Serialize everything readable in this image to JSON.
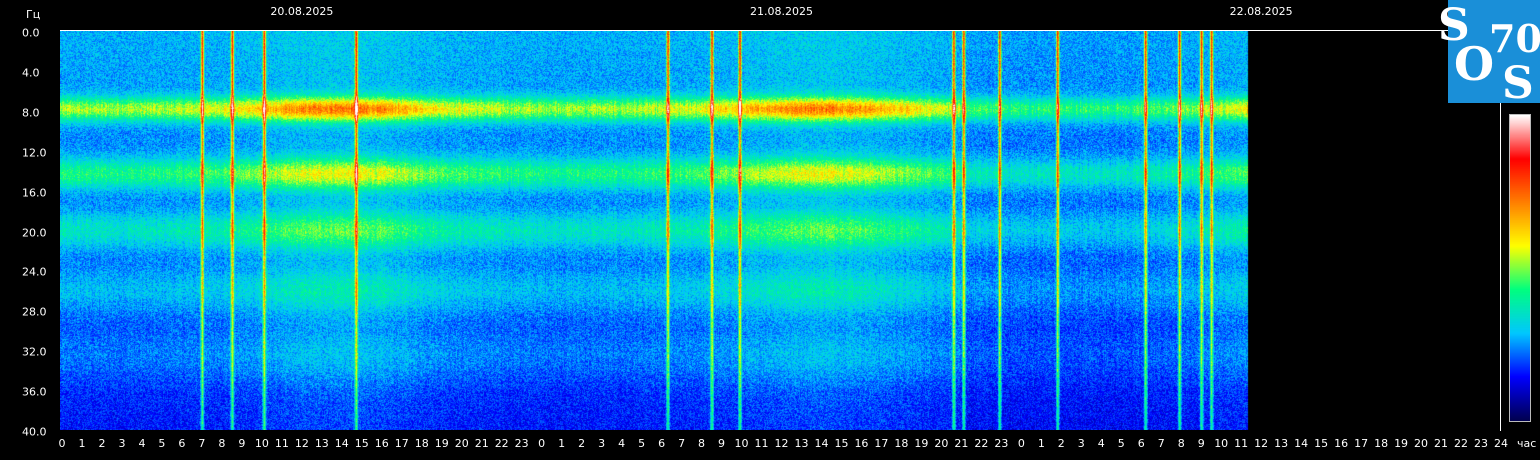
{
  "chart_data": {
    "type": "heatmap",
    "ylabel": "Гц",
    "xlabel": "час",
    "ylim": [
      0,
      40
    ],
    "y_ticks": [
      "0.0",
      "4.0",
      "8.0",
      "12.0",
      "16.0",
      "20.0",
      "24.0",
      "28.0",
      "32.0",
      "36.0",
      "40.0"
    ],
    "x_ticks": [
      "0",
      "1",
      "2",
      "3",
      "4",
      "5",
      "6",
      "7",
      "8",
      "9",
      "10",
      "11",
      "12",
      "13",
      "14",
      "15",
      "16",
      "17",
      "18",
      "19",
      "20",
      "21",
      "22",
      "23",
      "0",
      "1",
      "2",
      "3",
      "4",
      "5",
      "6",
      "7",
      "8",
      "9",
      "10",
      "11",
      "12",
      "13",
      "14",
      "15",
      "16",
      "17",
      "18",
      "19",
      "20",
      "21",
      "22",
      "23",
      "0",
      "1",
      "2",
      "3",
      "4",
      "5",
      "6",
      "7",
      "8",
      "9",
      "10",
      "11",
      "12",
      "13",
      "14",
      "15",
      "16",
      "17",
      "18",
      "19",
      "20",
      "21",
      "22",
      "23",
      "24"
    ],
    "dates": [
      "20.08.2025",
      "21.08.2025",
      "22.08.2025"
    ],
    "data_end_hour": 59.4,
    "resonance_bands_hz": [
      7.8,
      14.3,
      20.0,
      26.0,
      32.5
    ],
    "colorbar": [
      "#000050",
      "#0000ff",
      "#00c8ff",
      "#00ff80",
      "#ffff00",
      "#ff8000",
      "#ff0000",
      "#ffffff"
    ]
  },
  "logo": {
    "text": [
      "S",
      "70",
      "O",
      "S"
    ]
  }
}
